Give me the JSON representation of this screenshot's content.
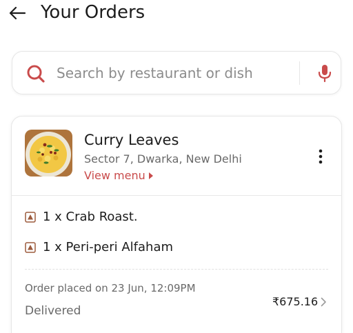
{
  "header": {
    "title": "Your Orders"
  },
  "search": {
    "placeholder": "Search by restaurant or dish"
  },
  "colors": {
    "accent": "#c94b4b",
    "nonveg": "#9c5a3c"
  },
  "order": {
    "restaurant_name": "Curry Leaves",
    "restaurant_address": "Sector 7, Dwarka, New Delhi",
    "view_menu_label": "View menu",
    "items": [
      {
        "text": "1 x Crab Roast.",
        "diet_icon": "non-veg-icon"
      },
      {
        "text": "1 x Peri-peri Alfaham",
        "diet_icon": "non-veg-icon"
      }
    ],
    "placed_on": "Order placed on 23 Jun, 12:09PM",
    "status": "Delivered",
    "total": "₹675.16"
  }
}
